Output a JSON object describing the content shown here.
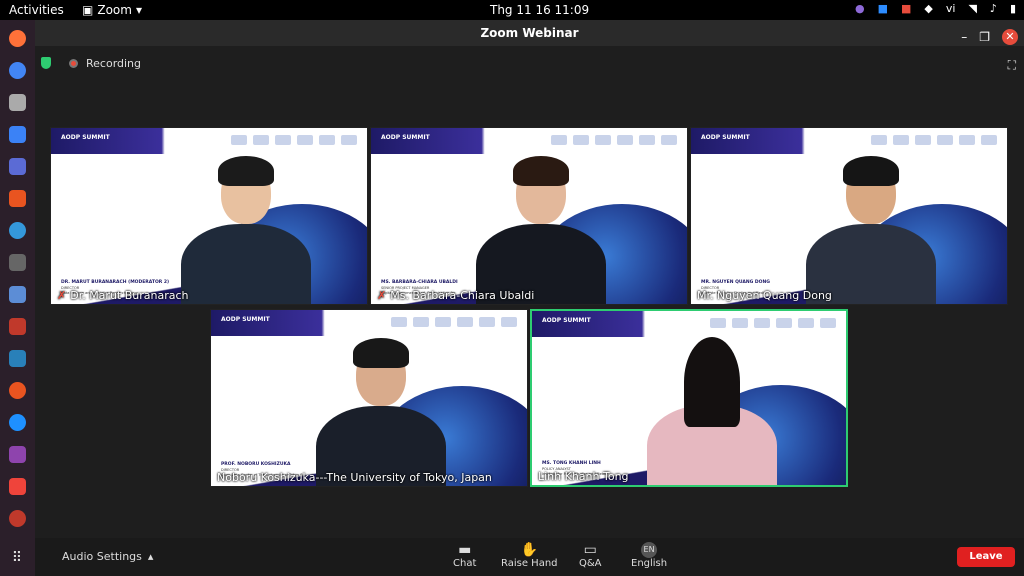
{
  "topbar": {
    "activities": "Activities",
    "app": "Zoom",
    "clock": "Thg 11 16  11:09",
    "lang": "vi",
    "icons": [
      "viber-icon",
      "zoom-icon",
      "mail-icon",
      "dropbox-icon",
      "wifi-icon",
      "volume-icon",
      "battery-icon"
    ]
  },
  "window": {
    "title": "Zoom Webinar",
    "recording": "Recording"
  },
  "tiles": [
    {
      "label": "Dr. Marut Buranarach",
      "muted": true,
      "slide_name": "DR. MARUT BURANARACH (MODERATOR 2)",
      "slide_title": "DIRECTOR",
      "slide_org": "Data Science and Analytics Research Group"
    },
    {
      "label": "Ms. Barbara-Chiara Ubaldi",
      "muted": true,
      "slide_name": "MS. BARBARA-CHIARA UBALDI",
      "slide_title": "SENIOR PROJECT MANAGER",
      "slide_org": "Digital Government Lead, Organisation for"
    },
    {
      "label": "Mr. Nguyen Quang Dong",
      "muted": false,
      "slide_name": "MR. NGUYEN QUANG DONG",
      "slide_title": "DIRECTOR",
      "slide_org": "Institute for Policy Studies and Media"
    },
    {
      "label": "Noboru Koshizuka---The University of Tokyo, Japan",
      "muted": false,
      "slide_name": "PROF. NOBORU KOSHIZUKA",
      "slide_title": "DIRECTOR",
      "slide_org": "Open Data Center of The University of Tokyo &"
    },
    {
      "label": "Linh Khanh Tong",
      "muted": false,
      "slide_name": "MS. TONG KHANH LINH",
      "slide_title": "POLICY ANALYST",
      "slide_org": "Institute for Policy Studies and Media"
    }
  ],
  "banner_logo": "AODP SUMMIT",
  "bottombar": {
    "audio_settings": "Audio Settings",
    "chat": "Chat",
    "raise_hand": "Raise Hand",
    "qa": "Q&A",
    "english": "English",
    "english_badge": "EN",
    "leave": "Leave"
  },
  "colors": {
    "accent_active": "#2ecc71",
    "leave": "#e02020",
    "banner": "#1e1a66"
  }
}
